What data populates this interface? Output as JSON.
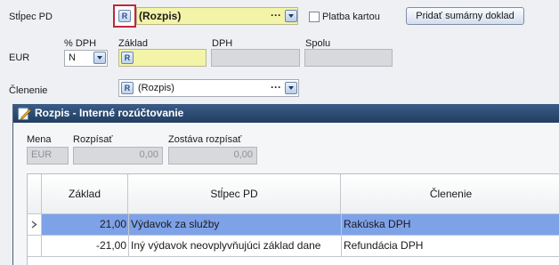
{
  "form": {
    "stlpec_label": "Stĺpec PD",
    "stlpec_value": "(Rozpis)",
    "stlpec_icon_letter": "R",
    "platba_label": "Platba kartou",
    "add_summary_button": "Pridať sumárny doklad",
    "dph_pct_label": "% DPH",
    "zaklad_label": "Základ",
    "dph_label": "DPH",
    "spolu_label": "Spolu",
    "currency_label": "EUR",
    "dph_pct_value": "N",
    "zaklad_icon_letter": "R",
    "clenenie_label": "Členenie",
    "clenenie_value": "(Rozpis)",
    "clenenie_icon_letter": "R",
    "dots": "···"
  },
  "dialog": {
    "title": "Rozpis - Interné rozúčtovanie",
    "mena_label": "Mena",
    "rozpisat_label": "Rozpísať",
    "zostava_label": "Zostáva rozpísať",
    "mena_value": "EUR",
    "rozpisat_value": "0,00",
    "zostava_value": "0,00",
    "table": {
      "columns": [
        "Základ",
        "Stĺpec PD",
        "Členenie"
      ],
      "rows": [
        {
          "zaklad": "21,00",
          "stlpec": "Výdavok za služby",
          "clenenie": "Rakúska DPH"
        },
        {
          "zaklad": "-21,00",
          "stlpec": "Iný výdavok neovplyvňujúci základ dane",
          "clenenie": "Refundácia DPH"
        }
      ]
    }
  },
  "colors": {
    "selected_row": "#7ea2e8",
    "highlight_border": "#c0283a",
    "title_bar": "#2b4a73",
    "yellow_field": "#f4f4a8"
  }
}
